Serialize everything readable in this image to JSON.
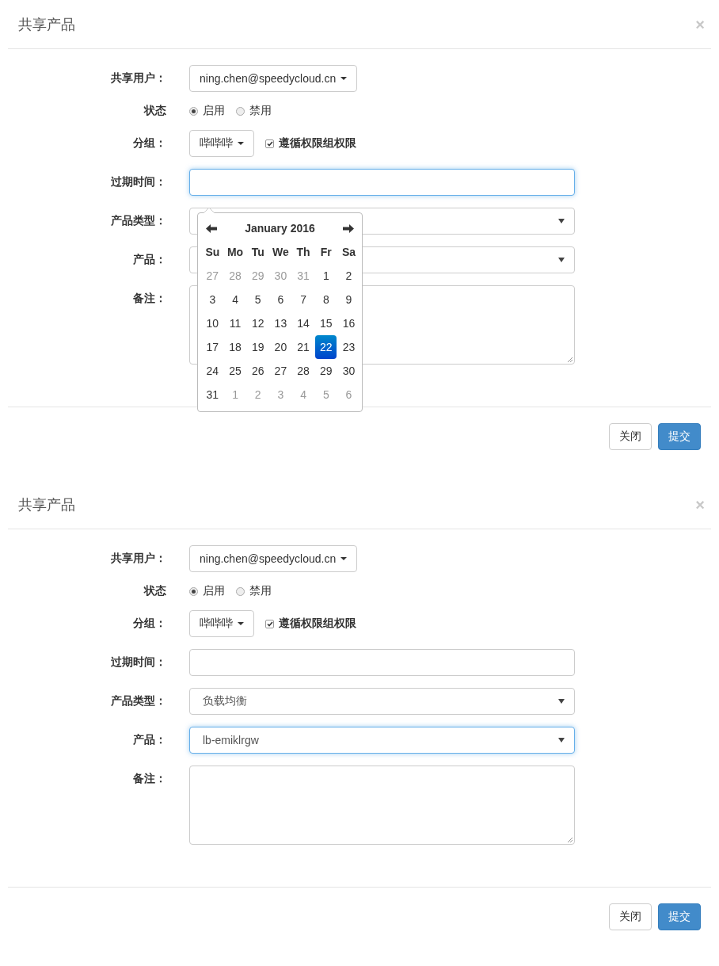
{
  "dialogs": [
    {
      "title": "共享产品",
      "close": "×",
      "fields": [
        {
          "kind": "dropdown",
          "label": "共享用户：",
          "value": "ning.chen@speedycloud.cn"
        },
        {
          "kind": "radio",
          "label": "状态",
          "options": [
            {
              "label": "启用",
              "selected": true
            },
            {
              "label": "禁用",
              "selected": false
            }
          ]
        },
        {
          "kind": "group",
          "label": "分组：",
          "value": "哔哔哔",
          "checkbox": {
            "label": "遵循权限组权限",
            "checked": true
          }
        },
        {
          "kind": "text",
          "label": "过期时间：",
          "focused": true
        },
        {
          "kind": "select",
          "label": "产品类型：",
          "focused": false
        },
        {
          "kind": "select",
          "label": "产品：",
          "focused": false
        },
        {
          "kind": "textarea",
          "label": "备注："
        }
      ],
      "datepicker": {
        "month": "January 2016",
        "weekdays": [
          "Su",
          "Mo",
          "Tu",
          "We",
          "Th",
          "Fr",
          "Sa"
        ],
        "weeks": [
          [
            {
              "day": "27",
              "muted": true,
              "selected": false
            },
            {
              "day": "28",
              "muted": true,
              "selected": false
            },
            {
              "day": "29",
              "muted": true,
              "selected": false
            },
            {
              "day": "30",
              "muted": true,
              "selected": false
            },
            {
              "day": "31",
              "muted": true,
              "selected": false
            },
            {
              "day": "1",
              "muted": false,
              "selected": false
            },
            {
              "day": "2",
              "muted": false,
              "selected": false
            }
          ],
          [
            {
              "day": "3",
              "muted": false,
              "selected": false
            },
            {
              "day": "4",
              "muted": false,
              "selected": false
            },
            {
              "day": "5",
              "muted": false,
              "selected": false
            },
            {
              "day": "6",
              "muted": false,
              "selected": false
            },
            {
              "day": "7",
              "muted": false,
              "selected": false
            },
            {
              "day": "8",
              "muted": false,
              "selected": false
            },
            {
              "day": "9",
              "muted": false,
              "selected": false
            }
          ],
          [
            {
              "day": "10",
              "muted": false,
              "selected": false
            },
            {
              "day": "11",
              "muted": false,
              "selected": false
            },
            {
              "day": "12",
              "muted": false,
              "selected": false
            },
            {
              "day": "13",
              "muted": false,
              "selected": false
            },
            {
              "day": "14",
              "muted": false,
              "selected": false
            },
            {
              "day": "15",
              "muted": false,
              "selected": false
            },
            {
              "day": "16",
              "muted": false,
              "selected": false
            }
          ],
          [
            {
              "day": "17",
              "muted": false,
              "selected": false
            },
            {
              "day": "18",
              "muted": false,
              "selected": false
            },
            {
              "day": "19",
              "muted": false,
              "selected": false
            },
            {
              "day": "20",
              "muted": false,
              "selected": false
            },
            {
              "day": "21",
              "muted": false,
              "selected": false
            },
            {
              "day": "22",
              "muted": false,
              "selected": true
            },
            {
              "day": "23",
              "muted": false,
              "selected": false
            }
          ],
          [
            {
              "day": "24",
              "muted": false,
              "selected": false
            },
            {
              "day": "25",
              "muted": false,
              "selected": false
            },
            {
              "day": "26",
              "muted": false,
              "selected": false
            },
            {
              "day": "27",
              "muted": false,
              "selected": false
            },
            {
              "day": "28",
              "muted": false,
              "selected": false
            },
            {
              "day": "29",
              "muted": false,
              "selected": false
            },
            {
              "day": "30",
              "muted": false,
              "selected": false
            }
          ],
          [
            {
              "day": "31",
              "muted": false,
              "selected": false
            },
            {
              "day": "1",
              "muted": true,
              "selected": false
            },
            {
              "day": "2",
              "muted": true,
              "selected": false
            },
            {
              "day": "3",
              "muted": true,
              "selected": false
            },
            {
              "day": "4",
              "muted": true,
              "selected": false
            },
            {
              "day": "5",
              "muted": true,
              "selected": false
            },
            {
              "day": "6",
              "muted": true,
              "selected": false
            }
          ]
        ]
      },
      "buttons": [
        {
          "label": "关闭",
          "kind": "default"
        },
        {
          "label": "提交",
          "kind": "primary"
        }
      ]
    },
    {
      "title": "共享产品",
      "close": "×",
      "fields": [
        {
          "kind": "dropdown",
          "label": "共享用户：",
          "value": "ning.chen@speedycloud.cn"
        },
        {
          "kind": "radio",
          "label": "状态",
          "options": [
            {
              "label": "启用",
              "selected": true
            },
            {
              "label": "禁用",
              "selected": false
            }
          ]
        },
        {
          "kind": "group",
          "label": "分组：",
          "value": "哔哔哔",
          "checkbox": {
            "label": "遵循权限组权限",
            "checked": true
          }
        },
        {
          "kind": "text",
          "label": "过期时间：",
          "focused": false
        },
        {
          "kind": "select",
          "label": "产品类型：",
          "value": "负载均衡",
          "focused": false
        },
        {
          "kind": "select",
          "label": "产品：",
          "value": "lb-emiklrgw",
          "focused": true
        },
        {
          "kind": "textarea",
          "label": "备注："
        }
      ],
      "buttons": [
        {
          "label": "关闭",
          "kind": "default"
        },
        {
          "label": "提交",
          "kind": "primary"
        }
      ]
    }
  ]
}
